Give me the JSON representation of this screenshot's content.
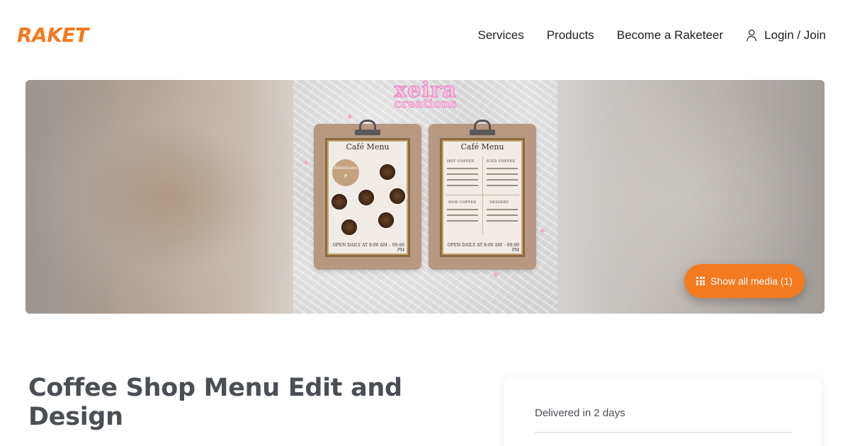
{
  "header": {
    "logo": "RAKET",
    "nav": {
      "services": "Services",
      "products": "Products",
      "become": "Become a Raketeer",
      "login": "Login / Join"
    }
  },
  "hero": {
    "media": {
      "brand_title": "xeira",
      "brand_subtitle": "creations",
      "menu_left": {
        "title": "Café Menu",
        "price_badge": "Americano ₱",
        "open_text": "OPEN DAILY AT 8:00 AM – 09:00 PM"
      },
      "menu_right": {
        "title": "Café Menu",
        "sections": [
          "HOT COFFEE",
          "ICED COFFEE",
          "NON COFFEE",
          "DESSERT"
        ],
        "open_text": "OPEN DAILY AT 8:00 AM – 09:00 PM"
      }
    },
    "show_media_button": "Show all media (1)"
  },
  "listing": {
    "title": "Coffee Shop Menu Edit and Design"
  },
  "side_card": {
    "delivery": "Delivered in 2 days"
  },
  "colors": {
    "accent": "#f47a20",
    "title_text": "#4a4f55",
    "brand_pink": "#f9c2e0"
  },
  "icons": {
    "user": "user-icon",
    "grid": "grid-icon"
  }
}
